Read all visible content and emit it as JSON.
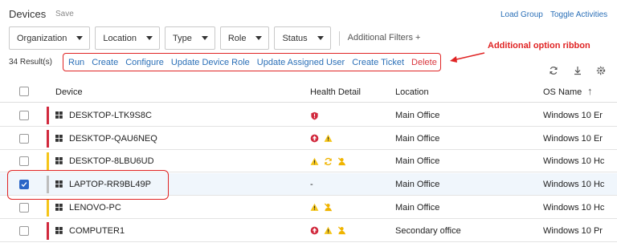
{
  "header": {
    "title": "Devices",
    "save_label": "Save",
    "load_group": "Load Group",
    "toggle_activities": "Toggle Activities"
  },
  "filters": {
    "items": [
      "Organization",
      "Location",
      "Type",
      "Role",
      "Status"
    ],
    "additional": "Additional Filters +"
  },
  "results": "34 Result(s)",
  "ribbon": {
    "run": "Run",
    "create": "Create",
    "configure": "Configure",
    "update_role": "Update Device Role",
    "update_user": "Update Assigned User",
    "create_ticket": "Create Ticket",
    "delete": "Delete"
  },
  "annotation": "Additional option ribbon",
  "columns": {
    "device": "Device",
    "health": "Health Detail",
    "location": "Location",
    "os": "OS Name",
    "sort_indicator": "↑"
  },
  "rows": [
    {
      "device": "DESKTOP-LTK9S8C",
      "health": [
        "shield-alert"
      ],
      "location": "Main Office",
      "os": "Windows 10 Er",
      "status_color": "#d1293d",
      "checked": false
    },
    {
      "device": "DESKTOP-QAU6NEQ",
      "health": [
        "up-alert",
        "warning"
      ],
      "location": "Main Office",
      "os": "Windows 10 Er",
      "status_color": "#d1293d",
      "checked": false
    },
    {
      "device": "DESKTOP-8LBU6UD",
      "health": [
        "warning",
        "refresh",
        "blocked-user"
      ],
      "location": "Main Office",
      "os": "Windows 10 Hc",
      "status_color": "#f5c518",
      "checked": false
    },
    {
      "device": "LAPTOP-RR9BL49P",
      "health_text": "-",
      "location": "Main Office",
      "os": "Windows 10 Hc",
      "status_color": "#bdbdbd",
      "checked": true
    },
    {
      "device": "LENOVO-PC",
      "health": [
        "warning",
        "blocked-user"
      ],
      "location": "Main Office",
      "os": "Windows 10 Hc",
      "status_color": "#f5c518",
      "checked": false
    },
    {
      "device": "COMPUTER1",
      "health": [
        "up-alert",
        "warning",
        "blocked-user"
      ],
      "location": "Secondary office",
      "os": "Windows 10 Pr",
      "status_color": "#d1293d",
      "checked": false
    }
  ]
}
